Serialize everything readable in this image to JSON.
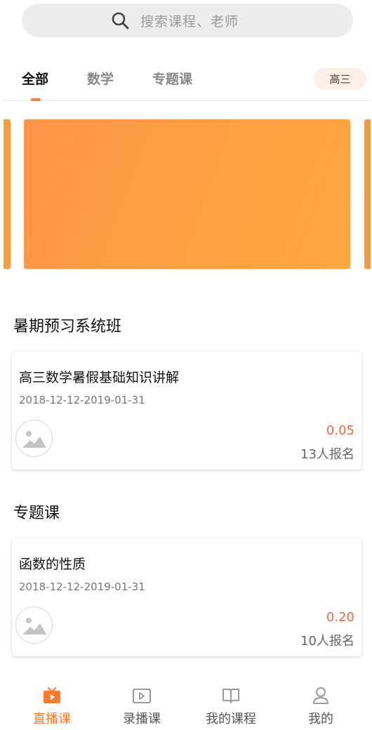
{
  "search": {
    "placeholder": "搜索课程、老师"
  },
  "tabs": [
    {
      "label": "全部",
      "active": true
    },
    {
      "label": "数学",
      "active": false
    },
    {
      "label": "专题课",
      "active": false
    }
  ],
  "grade_filter": {
    "label": "高三"
  },
  "colors": {
    "accent": "#ff7a2a",
    "price": "#f26a3a",
    "banner_start": "#ff9548",
    "banner_end": "#ffa83f"
  },
  "sections": [
    {
      "title": "暑期预习系统班",
      "course": {
        "title": "高三数学暑假基础知识讲解",
        "date": "2018-12-12-2019-01-31",
        "price": "0.05",
        "enrolled": "13人报名",
        "avatar_icon": "image-placeholder-icon"
      }
    },
    {
      "title": "专题课",
      "course": {
        "title": "函数的性质",
        "date": "2018-12-12-2019-01-31",
        "price": "0.20",
        "enrolled": "10人报名",
        "avatar_icon": "image-placeholder-icon"
      }
    }
  ],
  "bottom_nav": [
    {
      "label": "直播课",
      "icon": "live-tv-icon",
      "active": true
    },
    {
      "label": "录播课",
      "icon": "video-icon",
      "active": false
    },
    {
      "label": "我的课程",
      "icon": "book-icon",
      "active": false
    },
    {
      "label": "我的",
      "icon": "user-icon",
      "active": false
    }
  ]
}
